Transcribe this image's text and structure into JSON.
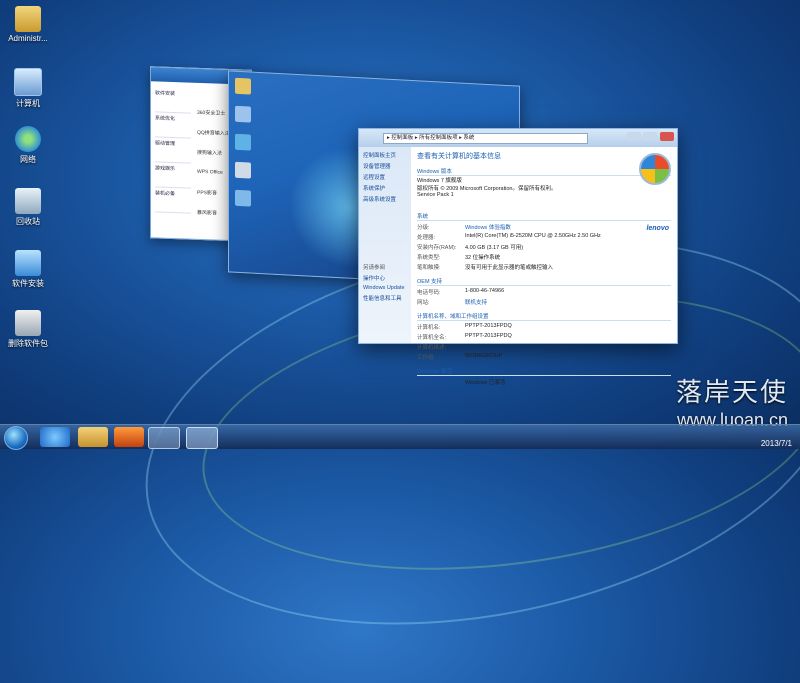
{
  "desktop_icons": [
    {
      "label": "Administr...",
      "icon": "user-folder-icon"
    },
    {
      "label": "计算机",
      "icon": "computer-icon"
    },
    {
      "label": "网络",
      "icon": "network-icon"
    },
    {
      "label": "回收站",
      "icon": "recycle-bin-icon"
    },
    {
      "label": "软件安装",
      "icon": "install-icon"
    },
    {
      "label": "删除软件包",
      "icon": "uninstall-icon"
    }
  ],
  "back_window": {
    "title": "软件安装管理器",
    "side_items": [
      "软件安装",
      "系统优化",
      "驱动管理",
      "游戏娱乐",
      "装机必备"
    ],
    "rows": [
      "360安全卫士",
      "QQ拼音输入法",
      "搜狗输入法",
      "WPS Office",
      "PPS影音",
      "暴风影音"
    ]
  },
  "front_window": {
    "breadcrumb": "▸ 控制面板 ▸ 所有控制面板项 ▸ 系统",
    "left_links": [
      "控制面板主页",
      "设备管理器",
      "远程设置",
      "系统保护",
      "高级系统设置"
    ],
    "left_bottom": [
      "另请参阅",
      "操作中心",
      "Windows Update",
      "性能信息和工具"
    ],
    "heading": "查看有关计算机的基本信息",
    "edition_section": "Windows 版本",
    "edition_lines": [
      "Windows 7 旗舰版",
      "版权所有 © 2009 Microsoft Corporation。保留所有权利。",
      "Service Pack 1"
    ],
    "system_section": "系统",
    "system_rows": [
      {
        "k": "分级:",
        "v": "Windows 体验指数"
      },
      {
        "k": "处理器:",
        "v": "Intel(R) Core(TM) i5-2520M CPU @ 2.50GHz  2.50 GHz"
      },
      {
        "k": "安装内存(RAM):",
        "v": "4.00 GB (3.17 GB 可用)"
      },
      {
        "k": "系统类型:",
        "v": "32 位操作系统"
      },
      {
        "k": "笔和触摸:",
        "v": "没有可用于此显示器的笔或触控输入"
      }
    ],
    "oem_section": "OEM 支持",
    "oem_rows": [
      {
        "k": "电话号码:",
        "v": "1-800-46-74966"
      },
      {
        "k": "网站:",
        "v": "联机支持"
      }
    ],
    "computer_section": "计算机名称、域和工作组设置",
    "computer_rows": [
      {
        "k": "计算机名:",
        "v": "PPTPT-2013FPDQ"
      },
      {
        "k": "计算机全名:",
        "v": "PPTPT-2013FPDQ"
      },
      {
        "k": "计算机描述:",
        "v": ""
      },
      {
        "k": "工作组:",
        "v": "WORKGROUP"
      }
    ],
    "activation_section": "Windows 激活",
    "activation_row": {
      "k": "",
      "v": "Windows 已激活"
    },
    "brand": "lenovo"
  },
  "watermark": {
    "cn": "落岸天使",
    "url": "www.luoan.cn"
  },
  "taskbar": {
    "clock": "2013/7/1"
  }
}
